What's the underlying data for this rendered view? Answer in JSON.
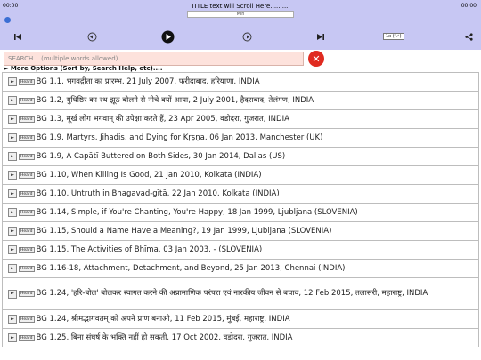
{
  "player": {
    "time_left": "00:00",
    "time_right": "00:00",
    "title": "TITLE text will Scroll Here..........",
    "seek_label": "Min",
    "speed": "1x (f✓)"
  },
  "search": {
    "placeholder": "SEARCH... (multiple words allowed)",
    "clear_symbol": "✕"
  },
  "more_options": "► More Options (Sort by, Search Help, etc)....",
  "list": {
    "play_symbol": "►",
    "heard_label": "Heard",
    "items": [
      "BG 1.1, भगवद्गीता का प्रारम्भ, 21 July 2007, फरीदाबाद, हरियाणा, INDIA",
      "BG 1.2, युधिष्ठिर का रथ झूठ बोलने से नीचे क्यों आया, 2 July 2001, हैदराबाद, तेलंगण, INDIA",
      "BG 1.3, मूर्ख लोग भगवान् की उपेक्षा करते हैं, 23 Apr 2005, वडोदरा, गुजरात, INDIA",
      "BG 1.9, Martyrs, Jihadis, and Dying for Kṛṣṇa, 06 Jan 2013, Manchester (UK)",
      "BG 1.9, A Capātī Buttered on Both Sides, 30 Jan 2014, Dallas (US)",
      "BG 1.10, When Killing Is Good, 21 Jan 2010, Kolkata (INDIA)",
      "BG 1.10, Untruth in Bhagavad-gītā, 22 Jan 2010, Kolkata (INDIA)",
      "BG 1.14, Simple, if You're Chanting, You're Happy, 18 Jan 1999, Ljubljana (SLOVENIA)",
      "BG 1.15, Should a Name Have a Meaning?, 19 Jan 1999, Ljubljana (SLOVENIA)",
      "BG 1.15, The Activities of Bhīma, 03 Jan 2003, - (SLOVENIA)",
      "BG 1.16-18, Attachment, Detachment, and Beyond, 25 Jan 2013, Chennai (INDIA)",
      "BG 1.24, 'हरि-बोल' बोलकर स्वागत करने की अप्रामाणिक परंपरा एवं नारकीय जीवन से बचाव, 12 Feb 2015, तलासरी, महाराष्ट्र, INDIA",
      "BG 1.24, श्रीमद्भागवतम् को अपने प्राण बनाओ, 11 Feb 2015, मुंबई, महाराष्ट्र, INDIA",
      "BG 1.25, बिना संघर्ष के भक्ति नहीं हो सकती, 17 Oct 2002, वडोदरा, गुजरात, INDIA"
    ]
  }
}
